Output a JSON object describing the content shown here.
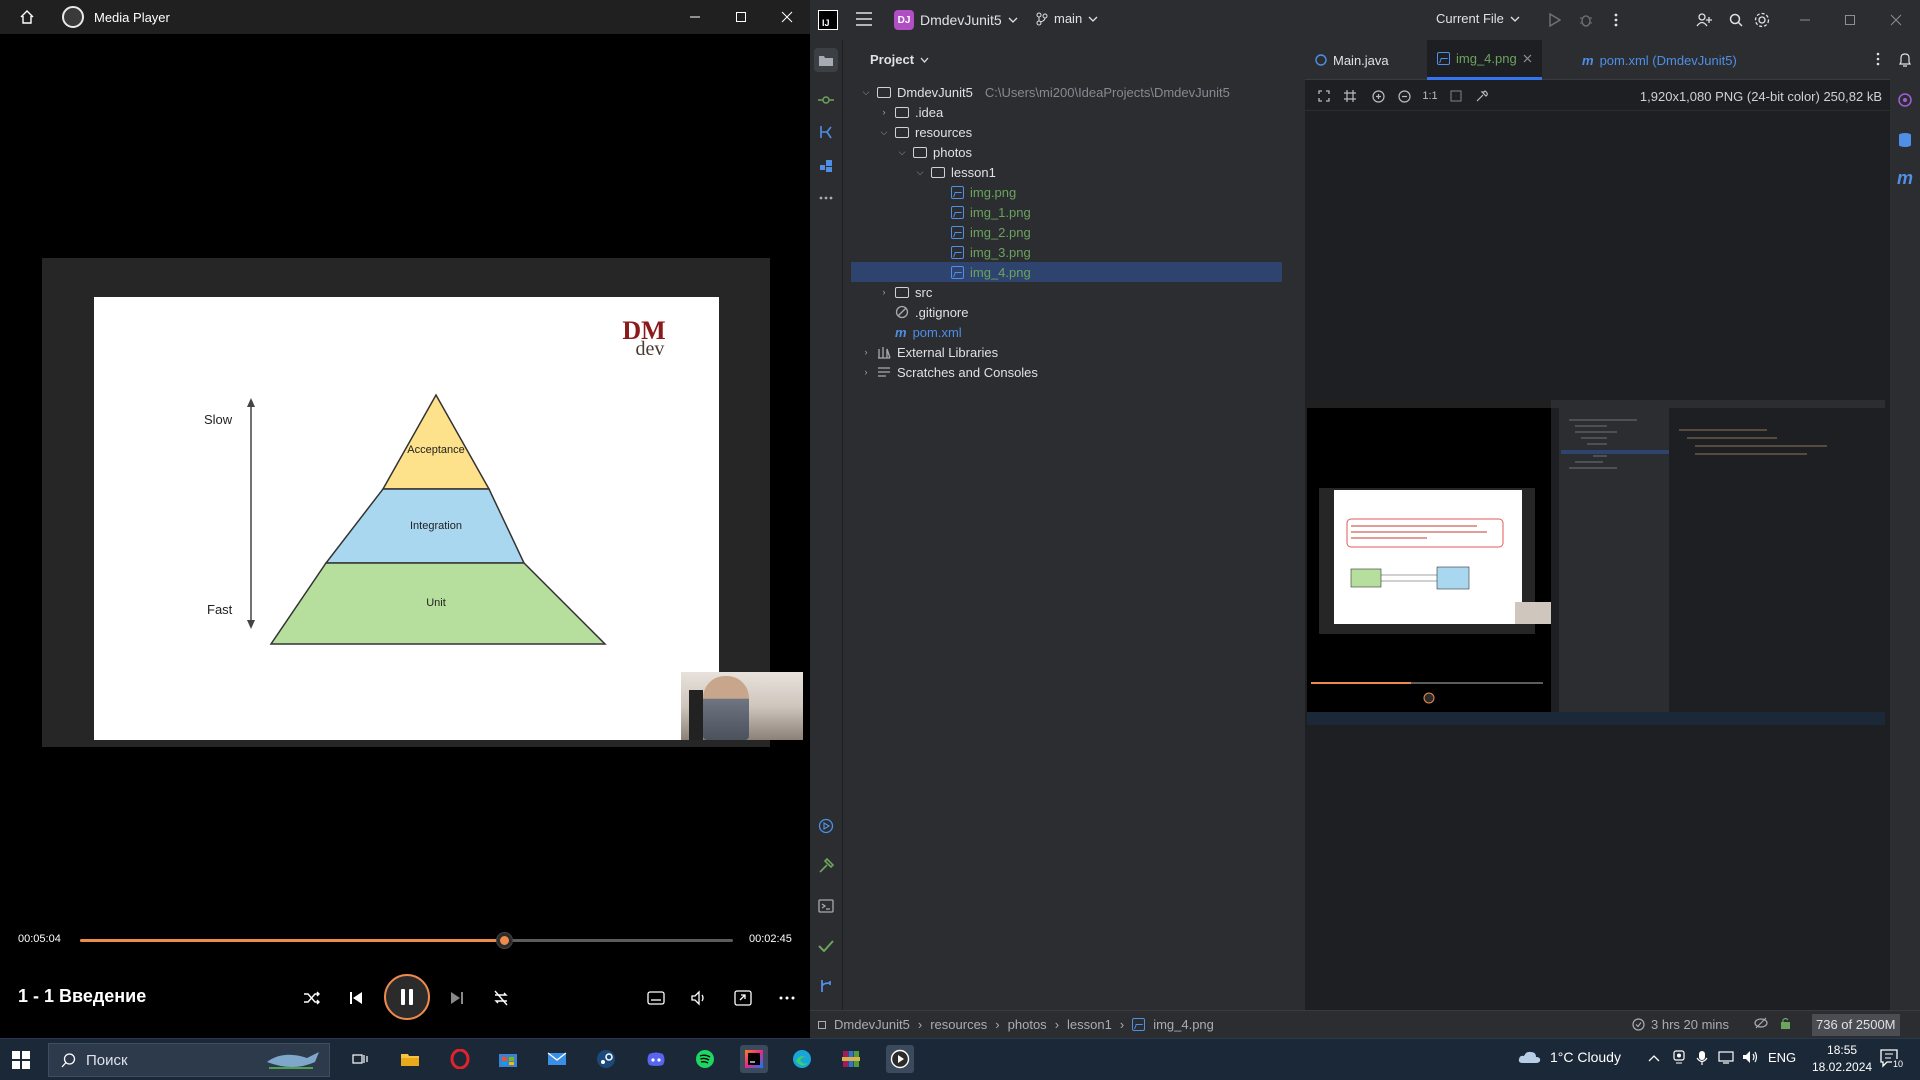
{
  "player": {
    "title": "Media Player",
    "current_time": "00:05:04",
    "remaining_time": "00:02:45",
    "progress": 0.65,
    "now_playing": "1 - 1 Введение",
    "slide": {
      "logo_top": "DM",
      "logo_bottom": "dev",
      "slow_label": "Slow",
      "fast_label": "Fast",
      "levels": [
        "Acceptance",
        "Integration",
        "Unit"
      ]
    }
  },
  "ide": {
    "project_name": "DmdevJunit5",
    "project_badge": "DJ",
    "branch": "main",
    "run_config": "Current File",
    "panel_title": "Project",
    "tree": [
      {
        "label": "DmdevJunit5",
        "path": "C:\\Users\\mi200\\IdeaProjects\\DmdevJunit5"
      },
      {
        "label": ".idea"
      },
      {
        "label": "resources"
      },
      {
        "label": "photos"
      },
      {
        "label": "lesson1"
      },
      {
        "label": "img.png"
      },
      {
        "label": "img_1.png"
      },
      {
        "label": "img_2.png"
      },
      {
        "label": "img_3.png"
      },
      {
        "label": "img_4.png"
      },
      {
        "label": "src"
      },
      {
        "label": ".gitignore"
      },
      {
        "label": "pom.xml"
      },
      {
        "label": "External Libraries"
      },
      {
        "label": "Scratches and Consoles"
      }
    ],
    "tabs": [
      {
        "label": "Main.java"
      },
      {
        "label": "img_4.png"
      },
      {
        "label": "pom.xml (DmdevJunit5)"
      }
    ],
    "zoom_label": "1:1",
    "image_info": "1,920x1,080 PNG (24-bit color) 250,82 kB",
    "breadcrumbs": [
      "DmdevJunit5",
      "resources",
      "photos",
      "lesson1",
      "img_4.png"
    ],
    "time_spent": "3 hrs 20 mins",
    "memory": "736 of 2500M"
  },
  "taskbar": {
    "search_placeholder": "Поиск",
    "weather": "1°C  Cloudy",
    "language": "ENG",
    "time": "18:55",
    "date": "18.02.2024",
    "notifications": "10"
  },
  "colors": {
    "accent": "#f08a4b",
    "ide_selection": "#2e436e",
    "tab_underline": "#3574f0",
    "file_green": "#6ca35e"
  }
}
